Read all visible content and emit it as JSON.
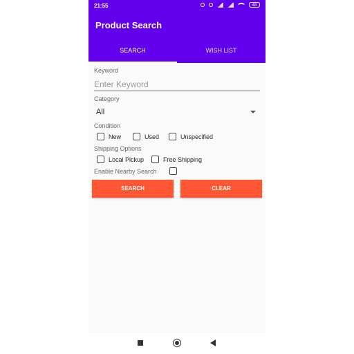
{
  "status_bar": {
    "time": "21:55",
    "battery": "48",
    "icons": [
      "bluetooth-icon",
      "alarm-icon",
      "signal-icon",
      "signal-icon",
      "wifi-icon",
      "battery-icon"
    ]
  },
  "app_bar": {
    "title": "Product Search",
    "color": "#6200ee",
    "tabs": [
      {
        "label": "SEARCH",
        "active": true
      },
      {
        "label": "WISH LIST",
        "active": false
      }
    ]
  },
  "form": {
    "keyword": {
      "label": "Keyword",
      "placeholder": "Enter Keyword",
      "value": ""
    },
    "category": {
      "label": "Category",
      "selected": "All"
    },
    "condition": {
      "label": "Condition",
      "options": [
        {
          "label": "New",
          "checked": false
        },
        {
          "label": "Used",
          "checked": false
        },
        {
          "label": "Unspecified",
          "checked": false
        }
      ]
    },
    "shipping": {
      "label": "Shipping Options",
      "options": [
        {
          "label": "Local Pickup",
          "checked": false
        },
        {
          "label": "Free Shipping",
          "checked": false
        }
      ]
    },
    "nearby": {
      "label": "Enable Nearby Search",
      "checked": false
    }
  },
  "buttons": {
    "search_label": "SEARCH",
    "clear_label": "CLEAR",
    "color": "#ff5733"
  },
  "nav_bar": {
    "icons": [
      "recents-square-icon",
      "home-circle-icon",
      "back-triangle-icon"
    ]
  }
}
